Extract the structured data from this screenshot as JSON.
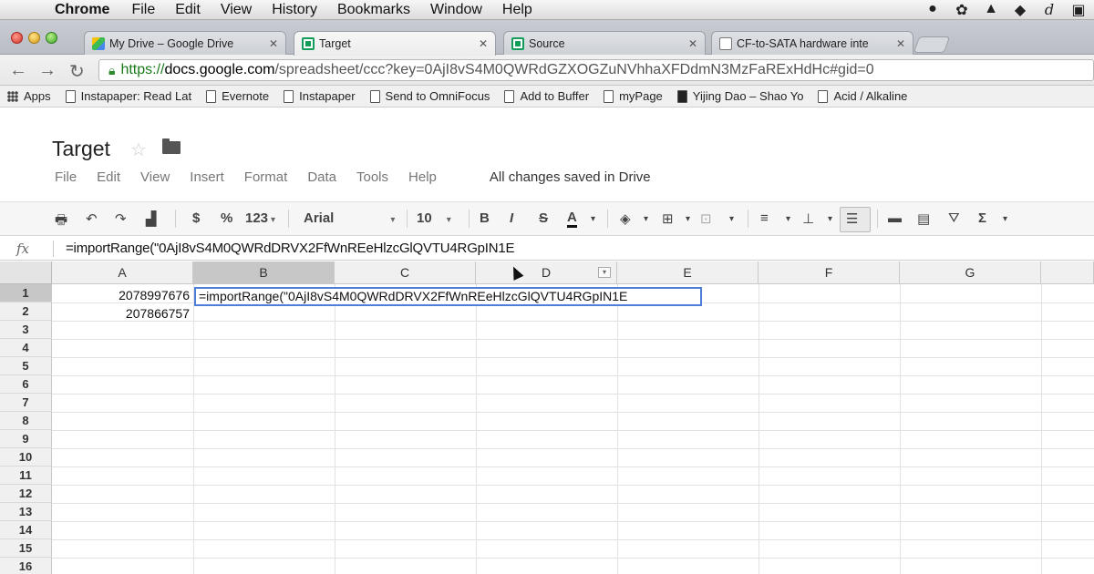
{
  "menubar": {
    "items": [
      "Chrome",
      "File",
      "Edit",
      "View",
      "History",
      "Bookmarks",
      "Window",
      "Help"
    ]
  },
  "tabs": [
    {
      "label": "My Drive – Google Drive",
      "icon": "drive-icon",
      "active": false
    },
    {
      "label": "Target",
      "icon": "sheets-icon",
      "active": true
    },
    {
      "label": "Source",
      "icon": "sheets-icon",
      "active": false
    },
    {
      "label": "CF-to-SATA hardware inte",
      "icon": "page-icon",
      "active": false
    }
  ],
  "omnibox": {
    "scheme": "https://",
    "host": "docs.google.com",
    "path": "/spreadsheet/ccc?key=0AjI8vS4M0QWRdGZXOGZuNVhhaXFDdmN3MzFaRExHdHc#gid=0"
  },
  "bookmarks": [
    "Apps",
    "Instapaper: Read Lat",
    "Evernote",
    "Instapaper",
    "Send to OmniFocus",
    "Add to Buffer",
    "myPage",
    "Yijing Dao – Shao Yo",
    "Acid / Alkaline"
  ],
  "document": {
    "title": "Target",
    "menu": [
      "File",
      "Edit",
      "View",
      "Insert",
      "Format",
      "Data",
      "Tools",
      "Help"
    ],
    "save_status": "All changes saved in Drive"
  },
  "toolbar": {
    "currency": "$",
    "percent": "%",
    "number_format": "123",
    "font": "Arial",
    "font_size": "10",
    "bold": "B",
    "italic": "I",
    "strike": "S",
    "text_color": "A",
    "sigma": "Σ"
  },
  "formula_bar": {
    "fx": "fx",
    "value": "=importRange(\"0AjI8vS4M0QWRdDRVX2FfWnREeHlzcGlQVTU4RGpIN1E"
  },
  "sheet": {
    "columns": [
      "A",
      "B",
      "C",
      "D",
      "E",
      "F",
      "G"
    ],
    "rows": [
      "1",
      "2",
      "3",
      "4",
      "5",
      "6",
      "7",
      "8",
      "9",
      "10",
      "11",
      "12",
      "13",
      "14",
      "15",
      "16"
    ],
    "a1": "2078997676",
    "a2": "207866757",
    "editor_value": "=importRange(\"0AjI8vS4M0QWRdDRVX2FfWnREeHlzcGlQVTU4RGpIN1E"
  }
}
